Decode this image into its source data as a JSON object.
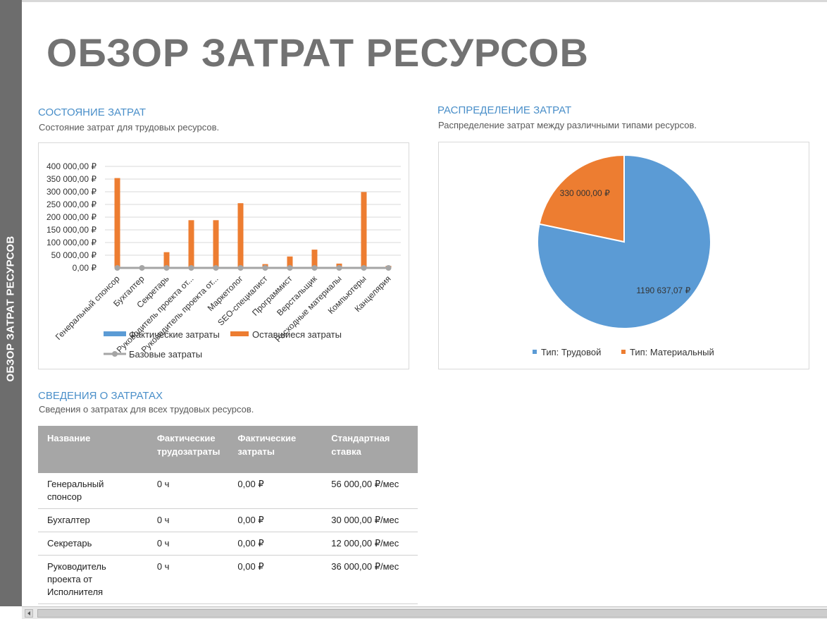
{
  "side_label": "ОБЗОР ЗАТРАТ РЕСУРСОВ",
  "title": "ОБЗОР ЗАТРАТ РЕСУРСОВ",
  "section_status": {
    "heading": "СОСТОЯНИЕ ЗАТРАТ",
    "subtitle": "Состояние затрат для трудовых ресурсов."
  },
  "section_distribution": {
    "heading": "РАСПРЕДЕЛЕНИЕ ЗАТРАТ",
    "subtitle": "Распределение затрат между различными типами ресурсов."
  },
  "section_details": {
    "heading": "СВЕДЕНИЯ О ЗАТРАТАХ",
    "subtitle": "Сведения о затратах для всех трудовых ресурсов."
  },
  "table": {
    "headers": [
      "Название",
      "Фактические трудозатраты",
      "Фактические затраты",
      "Стандартная ставка"
    ],
    "rows": [
      [
        "Генеральный спонсор",
        "0 ч",
        "0,00 ₽",
        "56 000,00 ₽/мес"
      ],
      [
        "Бухгалтер",
        "0 ч",
        "0,00 ₽",
        "30 000,00 ₽/мес"
      ],
      [
        "Секретарь",
        "0 ч",
        "0,00 ₽",
        "12 000,00 ₽/мес"
      ],
      [
        "Руководитель проекта от Исполнителя",
        "0 ч",
        "0,00 ₽",
        "36 000,00 ₽/мес"
      ]
    ]
  },
  "chart_data": [
    {
      "type": "bar",
      "categories": [
        "Генеральный спонсор",
        "Бухгалтер",
        "Секретарь",
        "Руководитель проекта от...",
        "Руководитель проекта от...",
        "Маркетолог",
        "SEO-специалист",
        "Программист",
        "Верстальщик",
        "Расходные материалы",
        "Компьютеры",
        "Канцелярия"
      ],
      "series": [
        {
          "name": "Фактические затраты",
          "color": "#5b9bd5",
          "values": [
            0,
            0,
            0,
            0,
            0,
            0,
            0,
            0,
            0,
            0,
            0,
            0
          ]
        },
        {
          "name": "Оставшиеся затраты",
          "color": "#ed7d31",
          "values": [
            354000,
            0,
            62000,
            188000,
            188000,
            255000,
            15000,
            45000,
            72000,
            17000,
            299000,
            8000
          ]
        },
        {
          "name": "Базовые затраты",
          "color": "#a5a5a5",
          "values": [
            0,
            0,
            0,
            0,
            0,
            0,
            0,
            0,
            0,
            0,
            0,
            0
          ]
        }
      ],
      "yticks": [
        "0,00 ₽",
        "50 000,00 ₽",
        "100 000,00 ₽",
        "150 000,00 ₽",
        "200 000,00 ₽",
        "250 000,00 ₽",
        "300 000,00 ₽",
        "350 000,00 ₽",
        "400 000,00 ₽"
      ],
      "ylim": [
        0,
        400000
      ],
      "grid": true,
      "legend": "bottom"
    },
    {
      "type": "pie",
      "slices": [
        {
          "name": "Тип: Трудовой",
          "value": 1190637.07,
          "label": "1190 637,07 ₽",
          "color": "#5b9bd5"
        },
        {
          "name": "Тип: Материальный",
          "value": 330000,
          "label": "330 000,00 ₽",
          "color": "#ed7d31"
        }
      ],
      "legend": "bottom"
    }
  ]
}
